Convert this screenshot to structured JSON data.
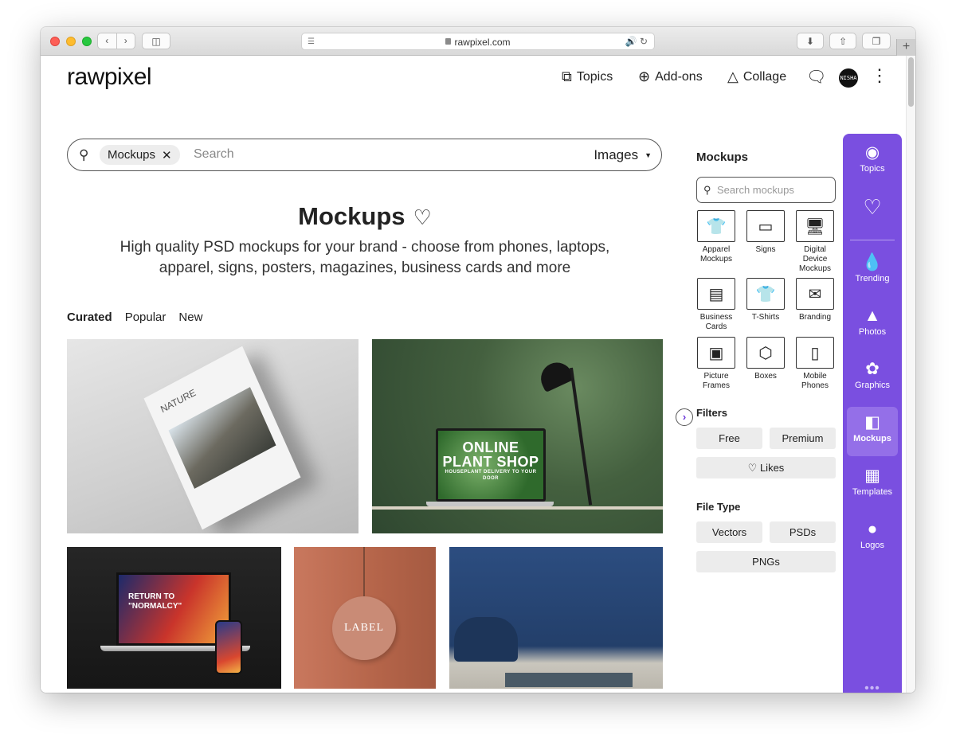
{
  "browser": {
    "url": "rawpixel.com",
    "back_icon": "chevron-left-icon",
    "forward_icon": "chevron-right-icon",
    "new_tab": "+"
  },
  "header": {
    "logo": "rawpixel",
    "nav": [
      {
        "label": "Topics",
        "icon": "topics-icon"
      },
      {
        "label": "Add-ons",
        "icon": "plus-circle-icon"
      },
      {
        "label": "Collage",
        "icon": "shapes-icon"
      }
    ],
    "avatar_text": "NISHA"
  },
  "search": {
    "chip": "Mockups",
    "placeholder": "Search",
    "type": "Images"
  },
  "hero": {
    "title": "Mockups",
    "subtitle": "High quality PSD mockups for your brand - choose from phones, laptops, apparel, signs, posters, magazines, business cards and more"
  },
  "tabs": [
    {
      "label": "Curated",
      "active": true
    },
    {
      "label": "Popular",
      "active": false
    },
    {
      "label": "New",
      "active": false
    }
  ],
  "images": {
    "magazine_title": "NATURE",
    "plant_line1": "ONLINE PLANT SHOP",
    "plant_line2": "HOUSEPLANT DELIVERY TO YOUR DOOR",
    "laptop_text": "RETURN TO \"NORMALCY\"",
    "label_text": "LABEL"
  },
  "panel": {
    "title": "Mockups",
    "search_placeholder": "Search mockups",
    "categories": [
      {
        "label": "Apparel Mockups",
        "icon": "shirt-icon"
      },
      {
        "label": "Signs",
        "icon": "sign-icon"
      },
      {
        "label": "Digital Device Mockups",
        "icon": "devices-icon"
      },
      {
        "label": "Business Cards",
        "icon": "business-card-icon"
      },
      {
        "label": "T-Shirts",
        "icon": "tshirt-icon"
      },
      {
        "label": "Branding",
        "icon": "branding-icon"
      },
      {
        "label": "Picture Frames",
        "icon": "frame-icon"
      },
      {
        "label": "Boxes",
        "icon": "box-icon"
      },
      {
        "label": "Mobile Phones",
        "icon": "phone-icon"
      }
    ],
    "filters_title": "Filters",
    "filters": [
      "Free",
      "Premium",
      "Likes"
    ],
    "filetype_title": "File Type",
    "filetypes": [
      "Vectors",
      "PSDs",
      "PNGs"
    ]
  },
  "sidebar": {
    "items": [
      {
        "label": "Topics",
        "icon": "topics-icon"
      },
      {
        "label": "",
        "icon": "heart-icon"
      },
      {
        "label": "Trending",
        "icon": "flame-icon"
      },
      {
        "label": "Photos",
        "icon": "photo-icon"
      },
      {
        "label": "Graphics",
        "icon": "graphics-icon"
      },
      {
        "label": "Mockups",
        "icon": "mockups-icon",
        "active": true
      },
      {
        "label": "Templates",
        "icon": "templates-icon"
      },
      {
        "label": "Logos",
        "icon": "logo-circle-icon"
      }
    ],
    "more": "•••"
  },
  "colors": {
    "accent": "#7a4fe0",
    "accent_active": "#946fe8",
    "pill_bg": "#ececec"
  }
}
